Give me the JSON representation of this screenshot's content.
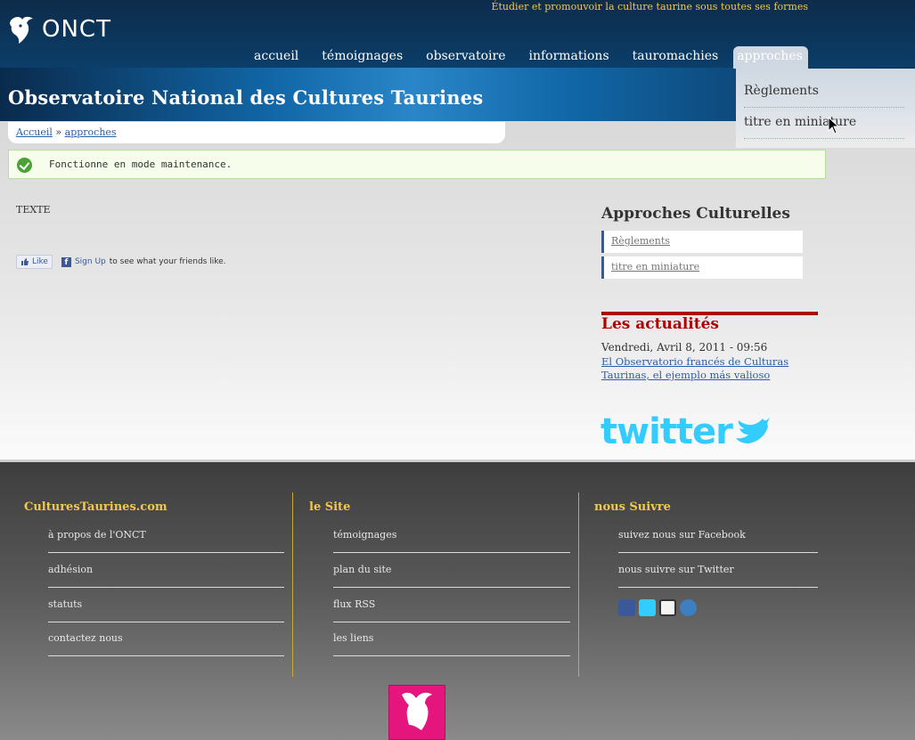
{
  "header": {
    "logo_text": "ONCT",
    "tagline": "Étudier et promouvoir la culture taurine sous toutes ses formes",
    "site_title": "Observatoire National des Cultures Taurines",
    "nav": [
      {
        "label": "accueil"
      },
      {
        "label": "témoignages"
      },
      {
        "label": "observatoire"
      },
      {
        "label": "informations"
      },
      {
        "label": "tauromachies"
      },
      {
        "label": "approches",
        "active": true
      }
    ],
    "dropdown": [
      "Règlements",
      "titre en miniature"
    ]
  },
  "breadcrumb": {
    "home": "Accueil",
    "separator": "»",
    "current": "approches"
  },
  "status": {
    "message": "Fonctionne en mode maintenance."
  },
  "content": {
    "text": "TEXTE"
  },
  "facebook": {
    "like_label": "Like",
    "signup_label": "Sign Up",
    "suffix": "to see what your friends like."
  },
  "sidebar": {
    "title": "Approches Culturelles",
    "links": [
      "Règlements",
      "titre en miniature"
    ],
    "news_title": "Les actualités",
    "news_date": "Vendredi, Avril 8, 2011 - 09:56",
    "news_link": "El Observatorio francés de Culturas Taurinas, el ejemplo más valioso",
    "twitter_label": "twitter"
  },
  "footer": {
    "columns": [
      {
        "title": "CulturesTaurines.com",
        "links": [
          "à propos de l'ONCT",
          "adhésion",
          "statuts",
          "contactez nous"
        ]
      },
      {
        "title": "le Site",
        "links": [
          "témoignages",
          "plan du site",
          "flux RSS",
          "les liens"
        ]
      },
      {
        "title": "nous Suivre",
        "links": [
          "suivez nous sur Facebook",
          "nous suivre sur Twitter"
        ]
      }
    ],
    "social_icons": [
      "facebook-icon",
      "twitter-icon",
      "netvibes-icon",
      "web-icon"
    ]
  },
  "colors": {
    "header": "#0b3a63",
    "accent_gold": "#f2c94c",
    "news_red": "#b00000",
    "link_blue": "#2a5ea8"
  }
}
